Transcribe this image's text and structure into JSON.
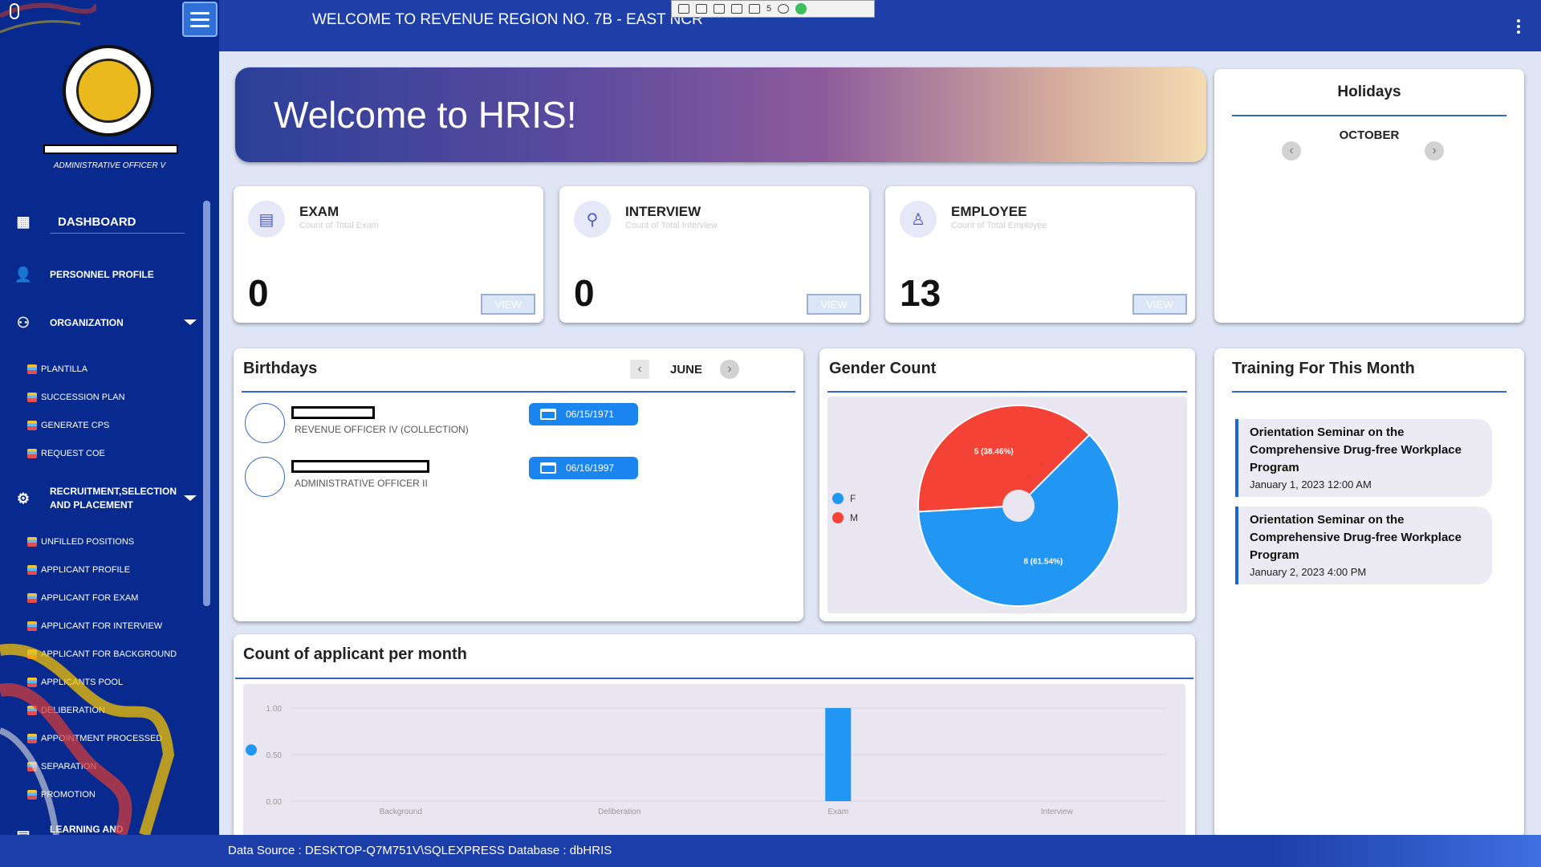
{
  "header": {
    "title": "WELCOME TO REVENUE REGION NO. 7B - EAST NCR"
  },
  "toolstrip": {
    "count": "5"
  },
  "sidebar": {
    "role": "ADMINISTRATIVE OFFICER V",
    "dashboard": "DASHBOARD",
    "personnel": "PERSONNEL PROFILE",
    "organization": "ORGANIZATION",
    "org_items": [
      "PLANTILLA",
      "SUCCESSION PLAN",
      "GENERATE CPS",
      "REQUEST COE"
    ],
    "recruitment": "RECRUITMENT,SELECTION AND PLACEMENT",
    "rec_items": [
      "UNFILLED POSITIONS",
      "APPLICANT PROFILE",
      "APPLICANT FOR EXAM",
      "APPLICANT FOR INTERVIEW",
      "APPLICANT FOR BACKGROUND",
      "APPLICANTS POOL",
      "DELIBERATION",
      "APPOINTMENT PROCESSED",
      "SEPARATION",
      "PROMOTION"
    ],
    "learning": "LEARNING AND DEVELOPMENT"
  },
  "banner": {
    "text": "Welcome to HRIS!"
  },
  "stats": [
    {
      "title": "EXAM",
      "subtitle": "Count of Total Exam",
      "value": "0",
      "view": "VIEW"
    },
    {
      "title": "INTERVIEW",
      "subtitle": "Count of Total Interview",
      "value": "0",
      "view": "VIEW"
    },
    {
      "title": "EMPLOYEE",
      "subtitle": "Count of Total Employee",
      "value": "13",
      "view": "VIEW"
    }
  ],
  "holidays": {
    "title": "Holidays",
    "month": "OCTOBER"
  },
  "birthdays": {
    "title": "Birthdays",
    "month": "JUNE",
    "people": [
      {
        "position": "REVENUE OFFICER IV (COLLECTION)",
        "date": "06/15/1971"
      },
      {
        "position": "ADMINISTRATIVE OFFICER II",
        "date": "06/16/1997"
      }
    ]
  },
  "gender": {
    "title": "Gender Count",
    "legend": [
      {
        "label": "F",
        "color": "#2196f3"
      },
      {
        "label": "M",
        "color": "#f44336"
      }
    ],
    "slices": [
      {
        "label": "M",
        "value": 5,
        "text": "5 (38.46%)",
        "color": "#f44336"
      },
      {
        "label": "F",
        "value": 8,
        "text": "8 (61.54%)",
        "color": "#2196f3"
      }
    ]
  },
  "training": {
    "title": "Training For This Month",
    "items": [
      {
        "name": "Orientation Seminar on the Comprehensive Drug-free Workplace Program",
        "date": "January 1, 2023 12:00 AM"
      },
      {
        "name": "Orientation Seminar on the Comprehensive Drug-free Workplace Program",
        "date": "January 2, 2023 4:00 PM"
      }
    ]
  },
  "applicants": {
    "title": "Count of applicant per month"
  },
  "chart_data": {
    "type": "bar",
    "title": "Count of applicant per month",
    "categories": [
      "Background",
      "Deliberation",
      "Exam",
      "Interview"
    ],
    "values": [
      0,
      0,
      1,
      0
    ],
    "yticks": [
      "0.00",
      "0.50",
      "1.00"
    ],
    "ylim": [
      0,
      1
    ],
    "color": "#2196f3"
  },
  "status": {
    "source": "Data Source : DESKTOP-Q7M751V\\SQLEXPRESS",
    "database": "Database : dbHRIS"
  }
}
